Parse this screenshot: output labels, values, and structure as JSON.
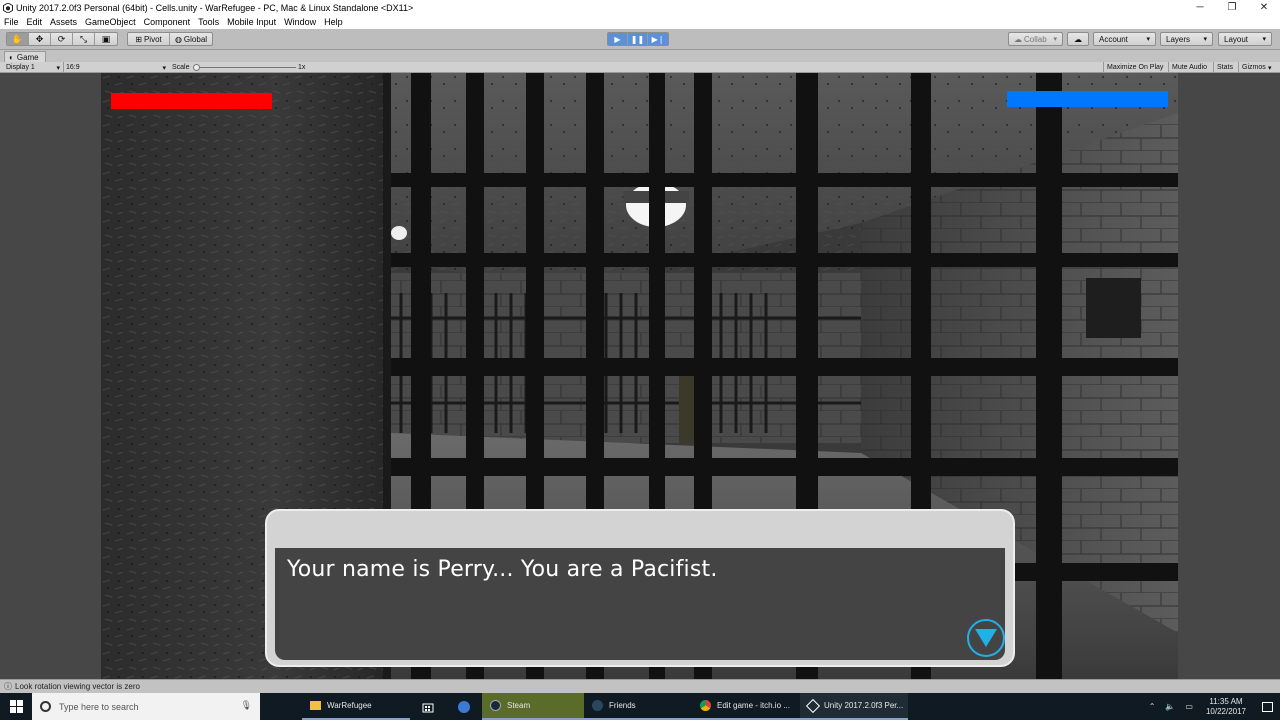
{
  "window": {
    "title": "Unity 2017.2.0f3 Personal (64bit) - Cells.unity - WarRefugee - PC, Mac & Linux Standalone <DX11>",
    "controls": [
      "minimize",
      "restore",
      "close"
    ]
  },
  "menu": [
    "File",
    "Edit",
    "Assets",
    "GameObject",
    "Component",
    "Tools",
    "Mobile Input",
    "Window",
    "Help"
  ],
  "toolbar": {
    "pivot_label": "Pivot",
    "global_label": "Global",
    "collab_label": "Collab",
    "account_label": "Account",
    "layers_label": "Layers",
    "layout_label": "Layout"
  },
  "game_view": {
    "tab_label": "Game",
    "display_label": "Display 1",
    "aspect_label": "16:9",
    "scale_label": "Scale",
    "scale_value": "1x",
    "maximize_label": "Maximize On Play",
    "mute_label": "Mute Audio",
    "stats_label": "Stats",
    "gizmos_label": "Gizmos"
  },
  "hud": {
    "left_bar_color": "#ff0000",
    "right_bar_color": "#0077ff"
  },
  "dialog": {
    "text": "Your name is Perry... You are a Pacifist.",
    "accent_color": "#22b0e8"
  },
  "console_status": "Look rotation viewing vector is zero",
  "taskbar": {
    "search_placeholder": "Type here to search",
    "apps": [
      {
        "label": "WarRefugee",
        "icon": "folder-icon"
      },
      {
        "label": "Steam",
        "icon": "steam-icon"
      },
      {
        "label": "Friends",
        "icon": "steam-icon"
      },
      {
        "label": "Edit game - itch.io ...",
        "icon": "chrome-icon"
      },
      {
        "label": "Unity 2017.2.0f3 Per...",
        "icon": "unity-icon"
      }
    ],
    "time": "11:35 AM",
    "date": "10/22/2017"
  }
}
